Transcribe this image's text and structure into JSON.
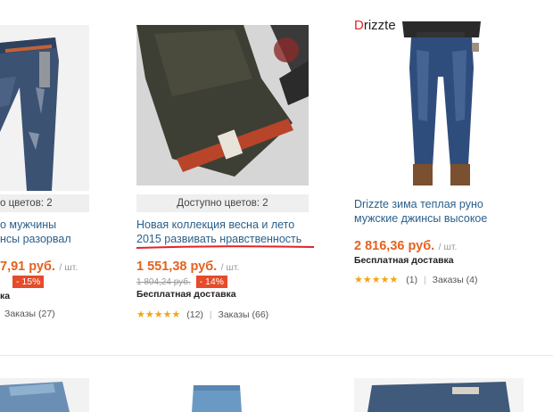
{
  "products": [
    {
      "colors": "о цветов: 2",
      "title_lines": [
        "о мужчины",
        "нсы разорвал"
      ],
      "price": "7,91 руб.",
      "unit": "/ шт.",
      "old_price": "",
      "discount": "- 15%",
      "shipping": "ка",
      "stars": "",
      "rating_count": "",
      "orders": "Заказы (27)"
    },
    {
      "colors": "Доступно цветов: 2",
      "title_lines": [
        "Новая коллекция весна и лето",
        "2015 развивать нравственность"
      ],
      "price": "1 551,38 руб.",
      "unit": "/ шт.",
      "old_price": "1 804,24 руб.",
      "discount": "- 14%",
      "shipping": "Бесплатная доставка",
      "stars": "★★★★★",
      "rating_count": "(12)",
      "orders": "Заказы (66)"
    },
    {
      "brand_first": "D",
      "brand_rest": "rizzte",
      "title_lines": [
        "Drizzte зима теплая руно",
        "мужские джинсы высокое"
      ],
      "price": "2 816,36 руб.",
      "unit": "/ шт.",
      "shipping": "Бесплатная доставка",
      "stars": "★★★★★",
      "rating_count": "(1)",
      "orders": "Заказы (4)"
    }
  ],
  "colors": {
    "price": "#e4621f",
    "discount_bg": "#e64b2a",
    "title": "#2a5f8c",
    "star": "#f4a512",
    "underline": "#e0242a"
  }
}
